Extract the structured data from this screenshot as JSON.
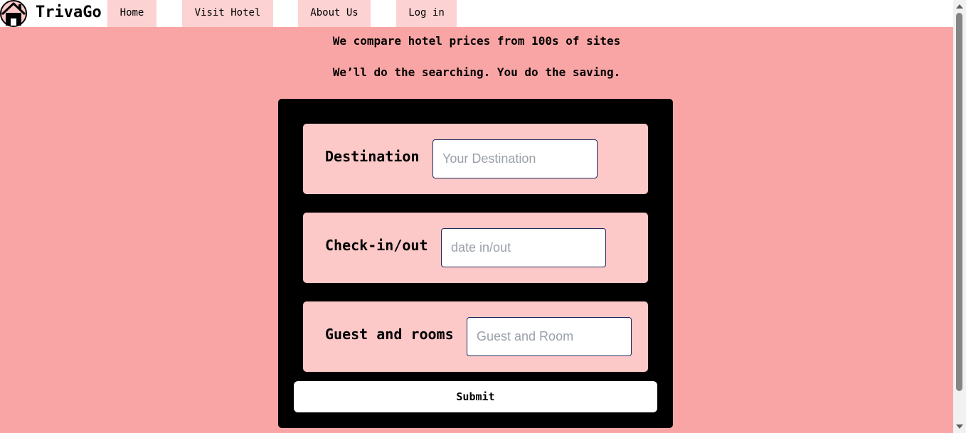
{
  "header": {
    "brand": "TrivaGo",
    "nav": [
      {
        "label": "Home"
      },
      {
        "label": "Visit Hotel"
      },
      {
        "label": "About Us"
      },
      {
        "label": "Log in"
      }
    ]
  },
  "hero": {
    "line1": "We compare hotel prices from 100s of sites",
    "line2": "We’ll do the searching. You do the saving."
  },
  "form": {
    "destination": {
      "label": "Destination",
      "placeholder": "Your Destination"
    },
    "checkin": {
      "label": "Check-in/out",
      "placeholder": "date in/out"
    },
    "guests": {
      "label": "Guest and rooms",
      "placeholder": "Guest and Room"
    },
    "submit_label": "Submit"
  },
  "icons": {
    "logo": "house-icon"
  }
}
